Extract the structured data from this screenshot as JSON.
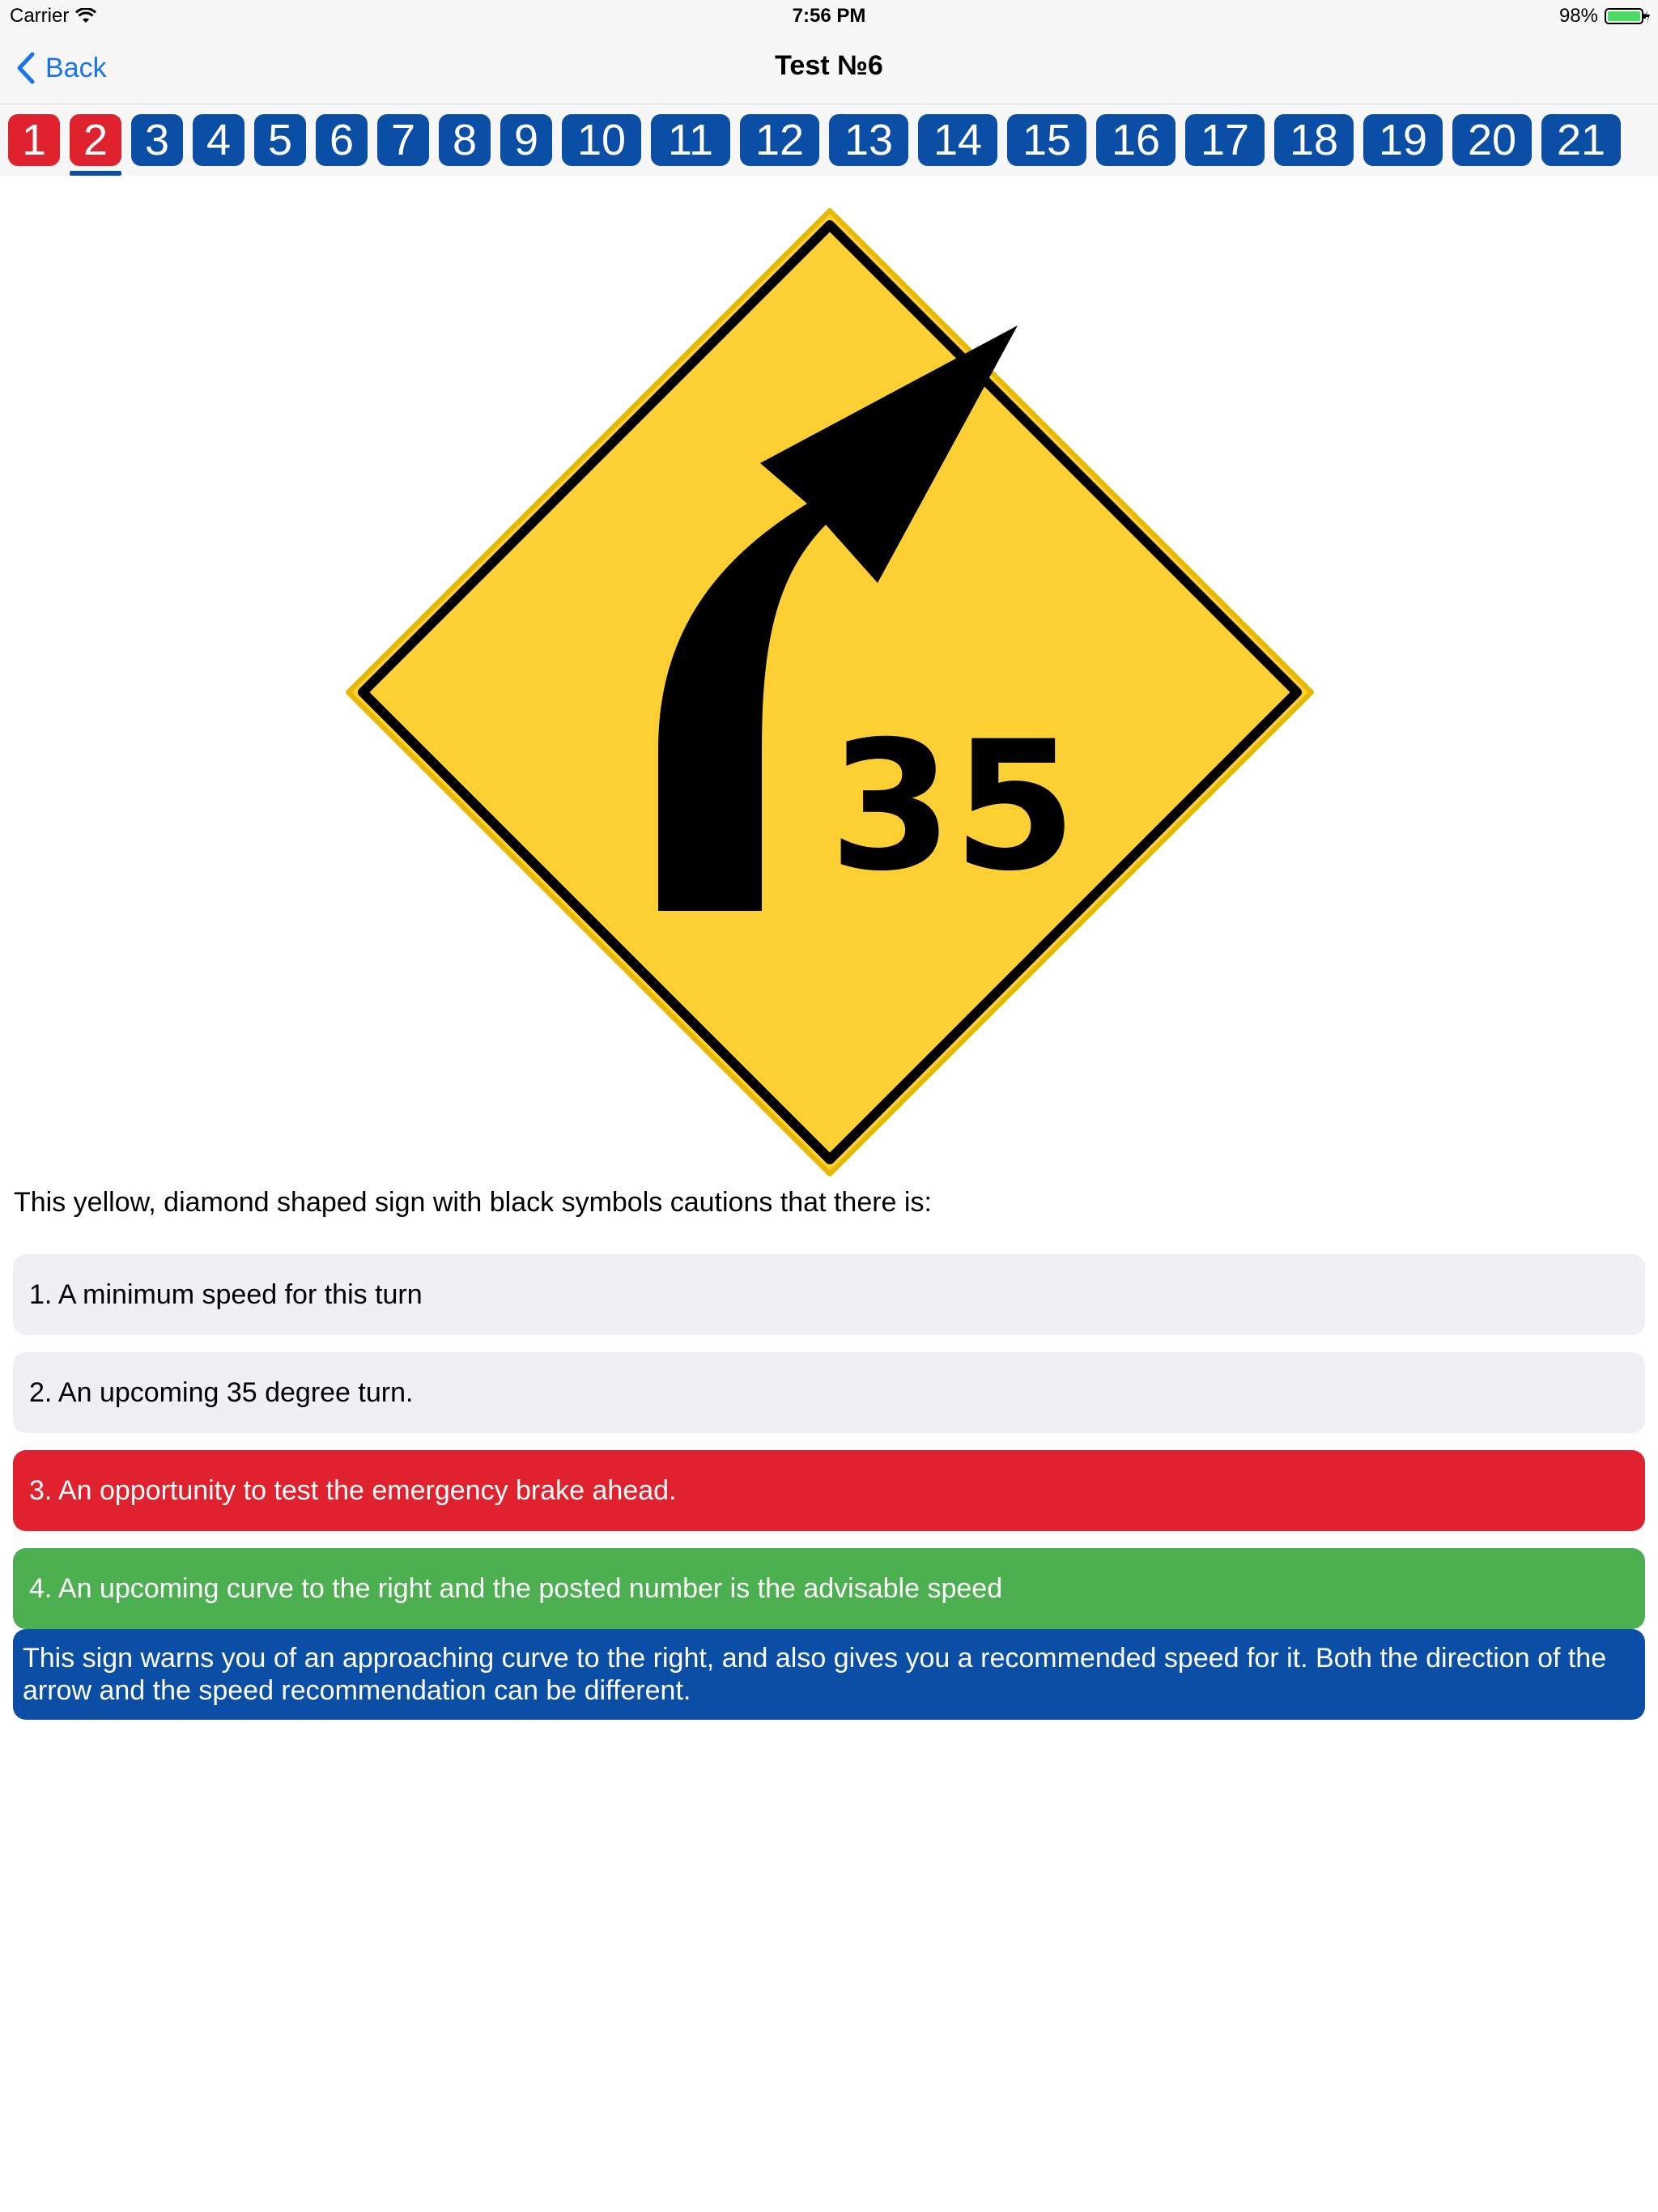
{
  "status_bar": {
    "carrier": "Carrier",
    "time": "7:56 PM",
    "battery": "98%"
  },
  "nav": {
    "back_label": "Back",
    "title": "Test №6"
  },
  "tabs": [
    "1",
    "2",
    "3",
    "4",
    "5",
    "6",
    "7",
    "8",
    "9",
    "10",
    "11",
    "12",
    "13",
    "14",
    "15",
    "16",
    "17",
    "18",
    "19",
    "20",
    "21"
  ],
  "tab_state": {
    "wrong": [
      "1",
      "2"
    ],
    "current": "2"
  },
  "sign": {
    "speed_text": "35",
    "colors": {
      "fill": "#fcd033",
      "symbol": "#000000"
    }
  },
  "question": "This yellow, diamond shaped sign with black symbols cautions that there is:",
  "answers": [
    {
      "text": "1. A minimum speed for this turn",
      "state": "neutral"
    },
    {
      "text": "2. An upcoming 35 degree turn.",
      "state": "neutral"
    },
    {
      "text": "3. An opportunity to test the emergency brake ahead.",
      "state": "wrong"
    },
    {
      "text": "4. An upcoming curve to the right and the posted number is the advisable speed",
      "state": "correct"
    }
  ],
  "explanation": "This sign warns you of an approaching curve to the right, and also gives you a recommended speed for it. Both the direction of the arrow and the speed recommendation can be different.",
  "colors": {
    "accent": "#0b4ea6",
    "wrong": "#e0212e",
    "correct": "#4caf50",
    "link": "#1a73f0",
    "neutral": "#efeff4"
  },
  "icons": {
    "wifi": "wifi-icon",
    "battery": "battery-icon",
    "back": "chevron-left-icon"
  }
}
